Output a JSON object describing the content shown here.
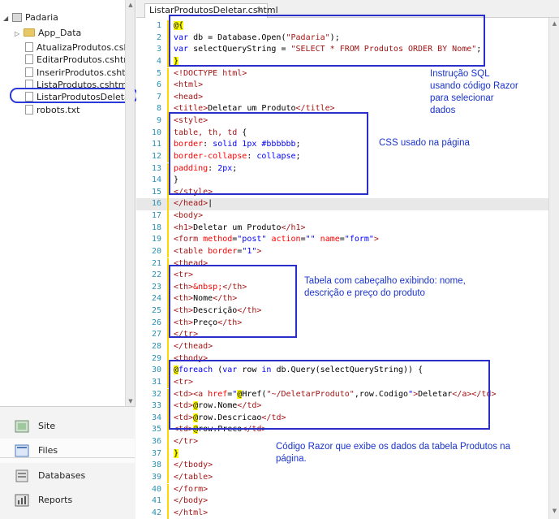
{
  "tree": {
    "root": "Padaria",
    "folder": "App_Data",
    "files": [
      "AtualizaProdutos.cshtml",
      "EditarProdutos.cshtml",
      "InserirProdutos.cshtml",
      "ListaProdutos.cshtml",
      "ListarProdutosDeletar.csht",
      "robots.txt"
    ]
  },
  "nav": {
    "site": "Site",
    "files": "Files",
    "databases": "Databases",
    "reports": "Reports"
  },
  "tab": {
    "title": "ListarProdutosDeletar.cshtml",
    "close": "×"
  },
  "code_lines": [
    [
      {
        "c": "razor",
        "t": "@{"
      }
    ],
    [
      {
        "c": "kw",
        "t": "var"
      },
      {
        "c": "plain",
        "t": " db = Database.Open("
      },
      {
        "c": "str",
        "t": "\"Padaria\""
      },
      {
        "c": "plain",
        "t": ");"
      }
    ],
    [
      {
        "c": "kw",
        "t": "var"
      },
      {
        "c": "plain",
        "t": " selectQueryString = "
      },
      {
        "c": "str",
        "t": "\"SELECT * FROM Produtos ORDER BY Nome\""
      },
      {
        "c": "plain",
        "t": ";"
      }
    ],
    [
      {
        "c": "razor",
        "t": "}"
      }
    ],
    [
      {
        "c": "tag",
        "t": "<!DOCTYPE html>"
      }
    ],
    [
      {
        "c": "tag",
        "t": "<html>"
      }
    ],
    [
      {
        "c": "tag",
        "t": "<head>"
      }
    ],
    [
      {
        "c": "tag",
        "t": "<title>"
      },
      {
        "c": "plain",
        "t": "Deletar um Produto"
      },
      {
        "c": "tag",
        "t": "</title>"
      }
    ],
    [
      {
        "c": "tag",
        "t": "<style>"
      }
    ],
    [
      {
        "c": "tag",
        "t": "table, th, td"
      },
      {
        "c": "plain",
        "t": " {"
      }
    ],
    [
      {
        "c": "css-prop",
        "t": "border"
      },
      {
        "c": "plain",
        "t": ": "
      },
      {
        "c": "css-val",
        "t": "solid 1px #bbbbbb"
      },
      {
        "c": "plain",
        "t": ";"
      }
    ],
    [
      {
        "c": "css-prop",
        "t": "border-collapse"
      },
      {
        "c": "plain",
        "t": ": "
      },
      {
        "c": "css-val",
        "t": "collapse"
      },
      {
        "c": "plain",
        "t": ";"
      }
    ],
    [
      {
        "c": "css-prop",
        "t": "padding"
      },
      {
        "c": "plain",
        "t": ": "
      },
      {
        "c": "css-val",
        "t": "2px"
      },
      {
        "c": "plain",
        "t": ";"
      }
    ],
    [
      {
        "c": "plain",
        "t": "}"
      }
    ],
    [
      {
        "c": "tag",
        "t": "</style>"
      }
    ],
    [
      {
        "c": "tag",
        "t": "</head>"
      },
      {
        "c": "plain",
        "t": "|"
      }
    ],
    [
      {
        "c": "tag",
        "t": "<body>"
      }
    ],
    [
      {
        "c": "tag",
        "t": "<h1>"
      },
      {
        "c": "plain",
        "t": "Deletar um Produto"
      },
      {
        "c": "tag",
        "t": "</h1>"
      }
    ],
    [
      {
        "c": "tag",
        "t": "<form "
      },
      {
        "c": "attr",
        "t": "method"
      },
      {
        "c": "plain",
        "t": "="
      },
      {
        "c": "kw",
        "t": "\"post\""
      },
      {
        "c": "plain",
        "t": " "
      },
      {
        "c": "attr",
        "t": "action"
      },
      {
        "c": "plain",
        "t": "="
      },
      {
        "c": "kw",
        "t": "\"\""
      },
      {
        "c": "plain",
        "t": " "
      },
      {
        "c": "attr",
        "t": "name"
      },
      {
        "c": "plain",
        "t": "="
      },
      {
        "c": "kw",
        "t": "\"form\""
      },
      {
        "c": "tag",
        "t": ">"
      }
    ],
    [
      {
        "c": "tag",
        "t": "<table "
      },
      {
        "c": "attr",
        "t": "border"
      },
      {
        "c": "plain",
        "t": "="
      },
      {
        "c": "kw",
        "t": "\"1\""
      },
      {
        "c": "tag",
        "t": ">"
      }
    ],
    [
      {
        "c": "tag",
        "t": "<thead>"
      }
    ],
    [
      {
        "c": "tag",
        "t": "<tr>"
      }
    ],
    [
      {
        "c": "tag",
        "t": "<th>"
      },
      {
        "c": "attr",
        "t": "&nbsp;"
      },
      {
        "c": "tag",
        "t": "</th>"
      }
    ],
    [
      {
        "c": "tag",
        "t": "<th>"
      },
      {
        "c": "plain",
        "t": "Nome"
      },
      {
        "c": "tag",
        "t": "</th>"
      }
    ],
    [
      {
        "c": "tag",
        "t": "<th>"
      },
      {
        "c": "plain",
        "t": "Descrição"
      },
      {
        "c": "tag",
        "t": "</th>"
      }
    ],
    [
      {
        "c": "tag",
        "t": "<th>"
      },
      {
        "c": "plain",
        "t": "Preço"
      },
      {
        "c": "tag",
        "t": "</th>"
      }
    ],
    [
      {
        "c": "tag",
        "t": "</tr>"
      }
    ],
    [
      {
        "c": "tag",
        "t": "</thead>"
      }
    ],
    [
      {
        "c": "tag",
        "t": "<tbody>"
      }
    ],
    [
      {
        "c": "razor",
        "t": "@"
      },
      {
        "c": "kw",
        "t": "foreach"
      },
      {
        "c": "plain",
        "t": " ("
      },
      {
        "c": "kw",
        "t": "var"
      },
      {
        "c": "plain",
        "t": " row "
      },
      {
        "c": "kw",
        "t": "in"
      },
      {
        "c": "plain",
        "t": " db.Query(selectQueryString)) {"
      }
    ],
    [
      {
        "c": "tag",
        "t": "<tr>"
      }
    ],
    [
      {
        "c": "tag",
        "t": "<td><a "
      },
      {
        "c": "attr",
        "t": "href"
      },
      {
        "c": "plain",
        "t": "="
      },
      {
        "c": "kw",
        "t": "\""
      },
      {
        "c": "razor",
        "t": "@"
      },
      {
        "c": "plain",
        "t": "Href("
      },
      {
        "c": "str",
        "t": "\"~/DeletarProduto\""
      },
      {
        "c": "plain",
        "t": ",row.Codigo"
      },
      {
        "c": "kw",
        "t": "\""
      },
      {
        "c": "tag",
        "t": ">"
      },
      {
        "c": "plain",
        "t": "Deletar"
      },
      {
        "c": "tag",
        "t": "</a></td>"
      }
    ],
    [
      {
        "c": "tag",
        "t": "<td>"
      },
      {
        "c": "razor",
        "t": "@"
      },
      {
        "c": "plain",
        "t": "row.Nome"
      },
      {
        "c": "tag",
        "t": "</td>"
      }
    ],
    [
      {
        "c": "tag",
        "t": "<td>"
      },
      {
        "c": "razor",
        "t": "@"
      },
      {
        "c": "plain",
        "t": "row.Descricao"
      },
      {
        "c": "tag",
        "t": "</td>"
      }
    ],
    [
      {
        "c": "tag",
        "t": "<td>"
      },
      {
        "c": "razor",
        "t": "@"
      },
      {
        "c": "plain",
        "t": "row.Preco"
      },
      {
        "c": "tag",
        "t": "</td>"
      }
    ],
    [
      {
        "c": "tag",
        "t": "</tr>"
      }
    ],
    [
      {
        "c": "razor",
        "t": "}"
      }
    ],
    [
      {
        "c": "tag",
        "t": "</tbody>"
      }
    ],
    [
      {
        "c": "tag",
        "t": "</table>"
      }
    ],
    [
      {
        "c": "tag",
        "t": "</form>"
      }
    ],
    [
      {
        "c": "tag",
        "t": "</body>"
      }
    ],
    [
      {
        "c": "tag",
        "t": "</html>"
      }
    ]
  ],
  "annotations": {
    "sql": "Instrução SQL usando código Razor para selecionar dados",
    "css": "CSS usado na página",
    "table": "Tabela com cabeçalho exibindo: nome, descrição e preço do produto",
    "razor": "Código Razor que exibe os dados da tabela Produtos na página."
  },
  "colors": {
    "annotation_blue": "#2a2fcc",
    "line_number": "#2b91af",
    "razor_highlight": "#ffff00"
  }
}
